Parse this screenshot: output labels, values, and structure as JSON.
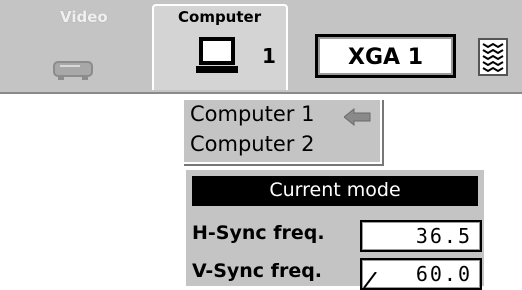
{
  "menu": {
    "tabs": [
      {
        "label": "Video",
        "icon": "video-projector-icon",
        "state": "inactive"
      },
      {
        "label": "Computer",
        "icon": "computer-monitor-icon",
        "state": "active"
      }
    ],
    "computer_number": "1",
    "mode_value": "XGA 1",
    "scroll_icon": "scroll-bar-icon"
  },
  "input_list": {
    "items": [
      "Computer 1",
      "Computer 2"
    ],
    "selected_index": 0,
    "selected_indicator_icon": "left-arrow-icon"
  },
  "mode_panel": {
    "title": "Current mode",
    "rows": [
      {
        "label": "H-Sync freq.",
        "value": "36.5"
      },
      {
        "label": "V-Sync freq.",
        "value": "60.0"
      }
    ]
  },
  "colors": {
    "menu_background": "#c4c4c4",
    "header_background": "#000000",
    "field_background": "#ffffff"
  }
}
